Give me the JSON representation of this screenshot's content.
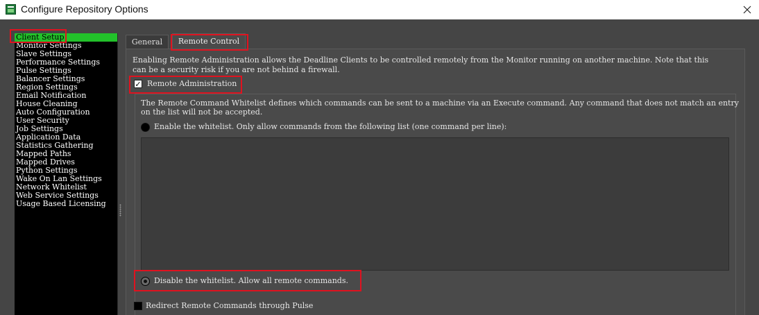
{
  "window": {
    "title": "Configure Repository Options"
  },
  "sidebar": {
    "items": [
      {
        "label": "Client Setup"
      },
      {
        "label": "Monitor Settings"
      },
      {
        "label": "Slave Settings"
      },
      {
        "label": "Performance Settings"
      },
      {
        "label": "Pulse Settings"
      },
      {
        "label": "Balancer Settings"
      },
      {
        "label": "Region Settings"
      },
      {
        "label": "Email Notification"
      },
      {
        "label": "House Cleaning"
      },
      {
        "label": "Auto Configuration"
      },
      {
        "label": "User Security"
      },
      {
        "label": "Job Settings"
      },
      {
        "label": "Application Data"
      },
      {
        "label": "Statistics Gathering"
      },
      {
        "label": "Mapped Paths"
      },
      {
        "label": "Mapped Drives"
      },
      {
        "label": "Python Settings"
      },
      {
        "label": "Wake On Lan Settings"
      },
      {
        "label": "Network Whitelist"
      },
      {
        "label": "Web Service Settings"
      },
      {
        "label": "Usage Based Licensing"
      }
    ],
    "selected": "Client Setup"
  },
  "tabs": [
    {
      "label": "General"
    },
    {
      "label": "Remote Control"
    }
  ],
  "active_tab": "Remote Control",
  "remote_control": {
    "description_line1": "Enabling Remote Administration allows the Deadline Clients to be controlled remotely from the Monitor running on another machine. Note that this",
    "description_line2": "can be a security risk if you are not behind a firewall.",
    "remote_admin_label": "Remote Administration",
    "remote_admin_checked": true,
    "whitelist_desc_line1": "The Remote Command Whitelist defines which commands can be sent to a machine via an Execute command. Any command that does not match an entry",
    "whitelist_desc_line2": "on the list will not be accepted.",
    "enable_whitelist_label": "Enable the whitelist. Only allow commands from the following list (one command per line):",
    "enable_whitelist_selected": false,
    "whitelist_text": "",
    "disable_whitelist_label": "Disable the whitelist. Allow all remote commands.",
    "disable_whitelist_selected": true,
    "redirect_label": "Redirect Remote Commands through Pulse",
    "redirect_checked": false
  },
  "colors": {
    "selection": "#22c12a",
    "highlight": "#e0121f",
    "background": "#454545"
  }
}
